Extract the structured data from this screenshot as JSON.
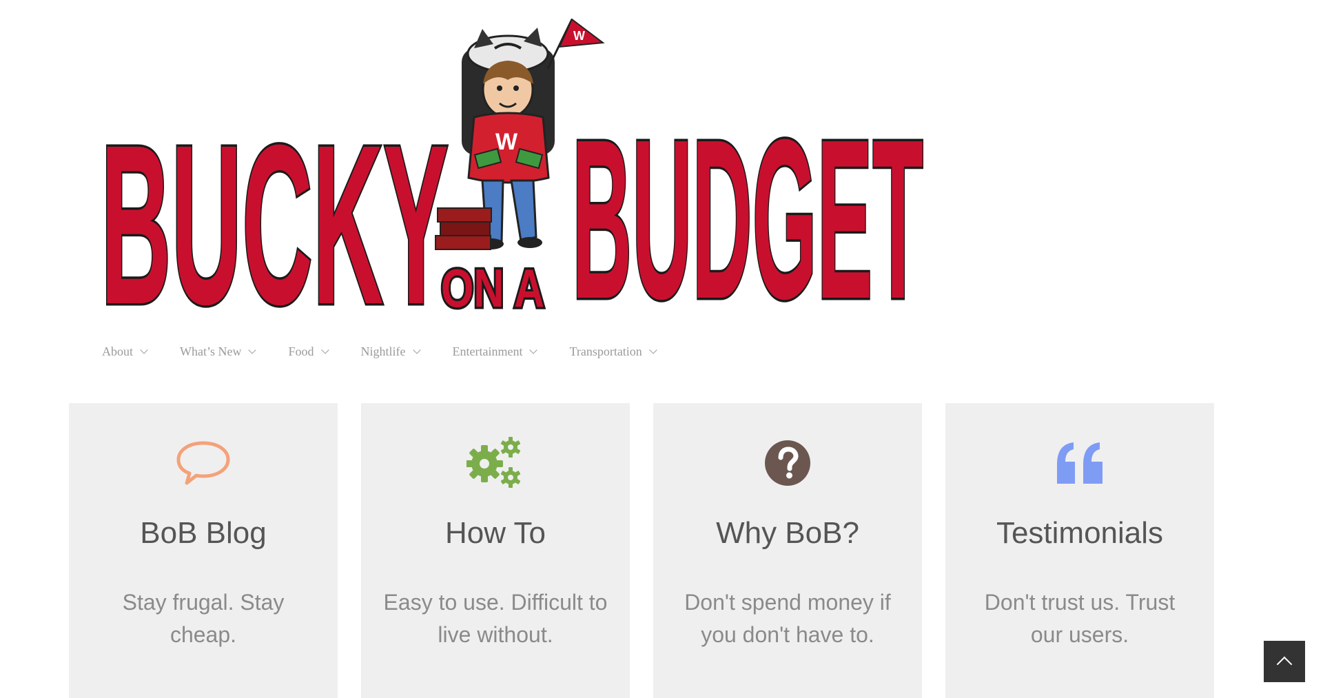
{
  "logo": {
    "word_left": "BUCKY",
    "word_small": "ON A",
    "word_right": "BUDGET",
    "shirt_letter": "W",
    "flag_letter": "W"
  },
  "nav": {
    "items": [
      {
        "label": "About"
      },
      {
        "label": "What’s New"
      },
      {
        "label": "Food"
      },
      {
        "label": "Nightlife"
      },
      {
        "label": "Entertainment"
      },
      {
        "label": "Transportation"
      }
    ]
  },
  "cards": [
    {
      "icon": "speech-bubble-icon",
      "icon_color": "#f4a27a",
      "title": "BoB Blog",
      "description": "Stay frugal. Stay cheap."
    },
    {
      "icon": "gears-icon",
      "icon_color": "#7cad4b",
      "title": "How To",
      "description": "Easy to use. Difficult to live without."
    },
    {
      "icon": "question-circle-icon",
      "icon_color": "#6b5750",
      "title": "Why BoB?",
      "description": "Don't spend money if you don't have to."
    },
    {
      "icon": "quote-icon",
      "icon_color": "#7f9cf5",
      "title": "Testimonials",
      "description": "Don't trust us. Trust our users."
    }
  ],
  "scroll_top": {
    "icon": "chevron-up-icon"
  }
}
